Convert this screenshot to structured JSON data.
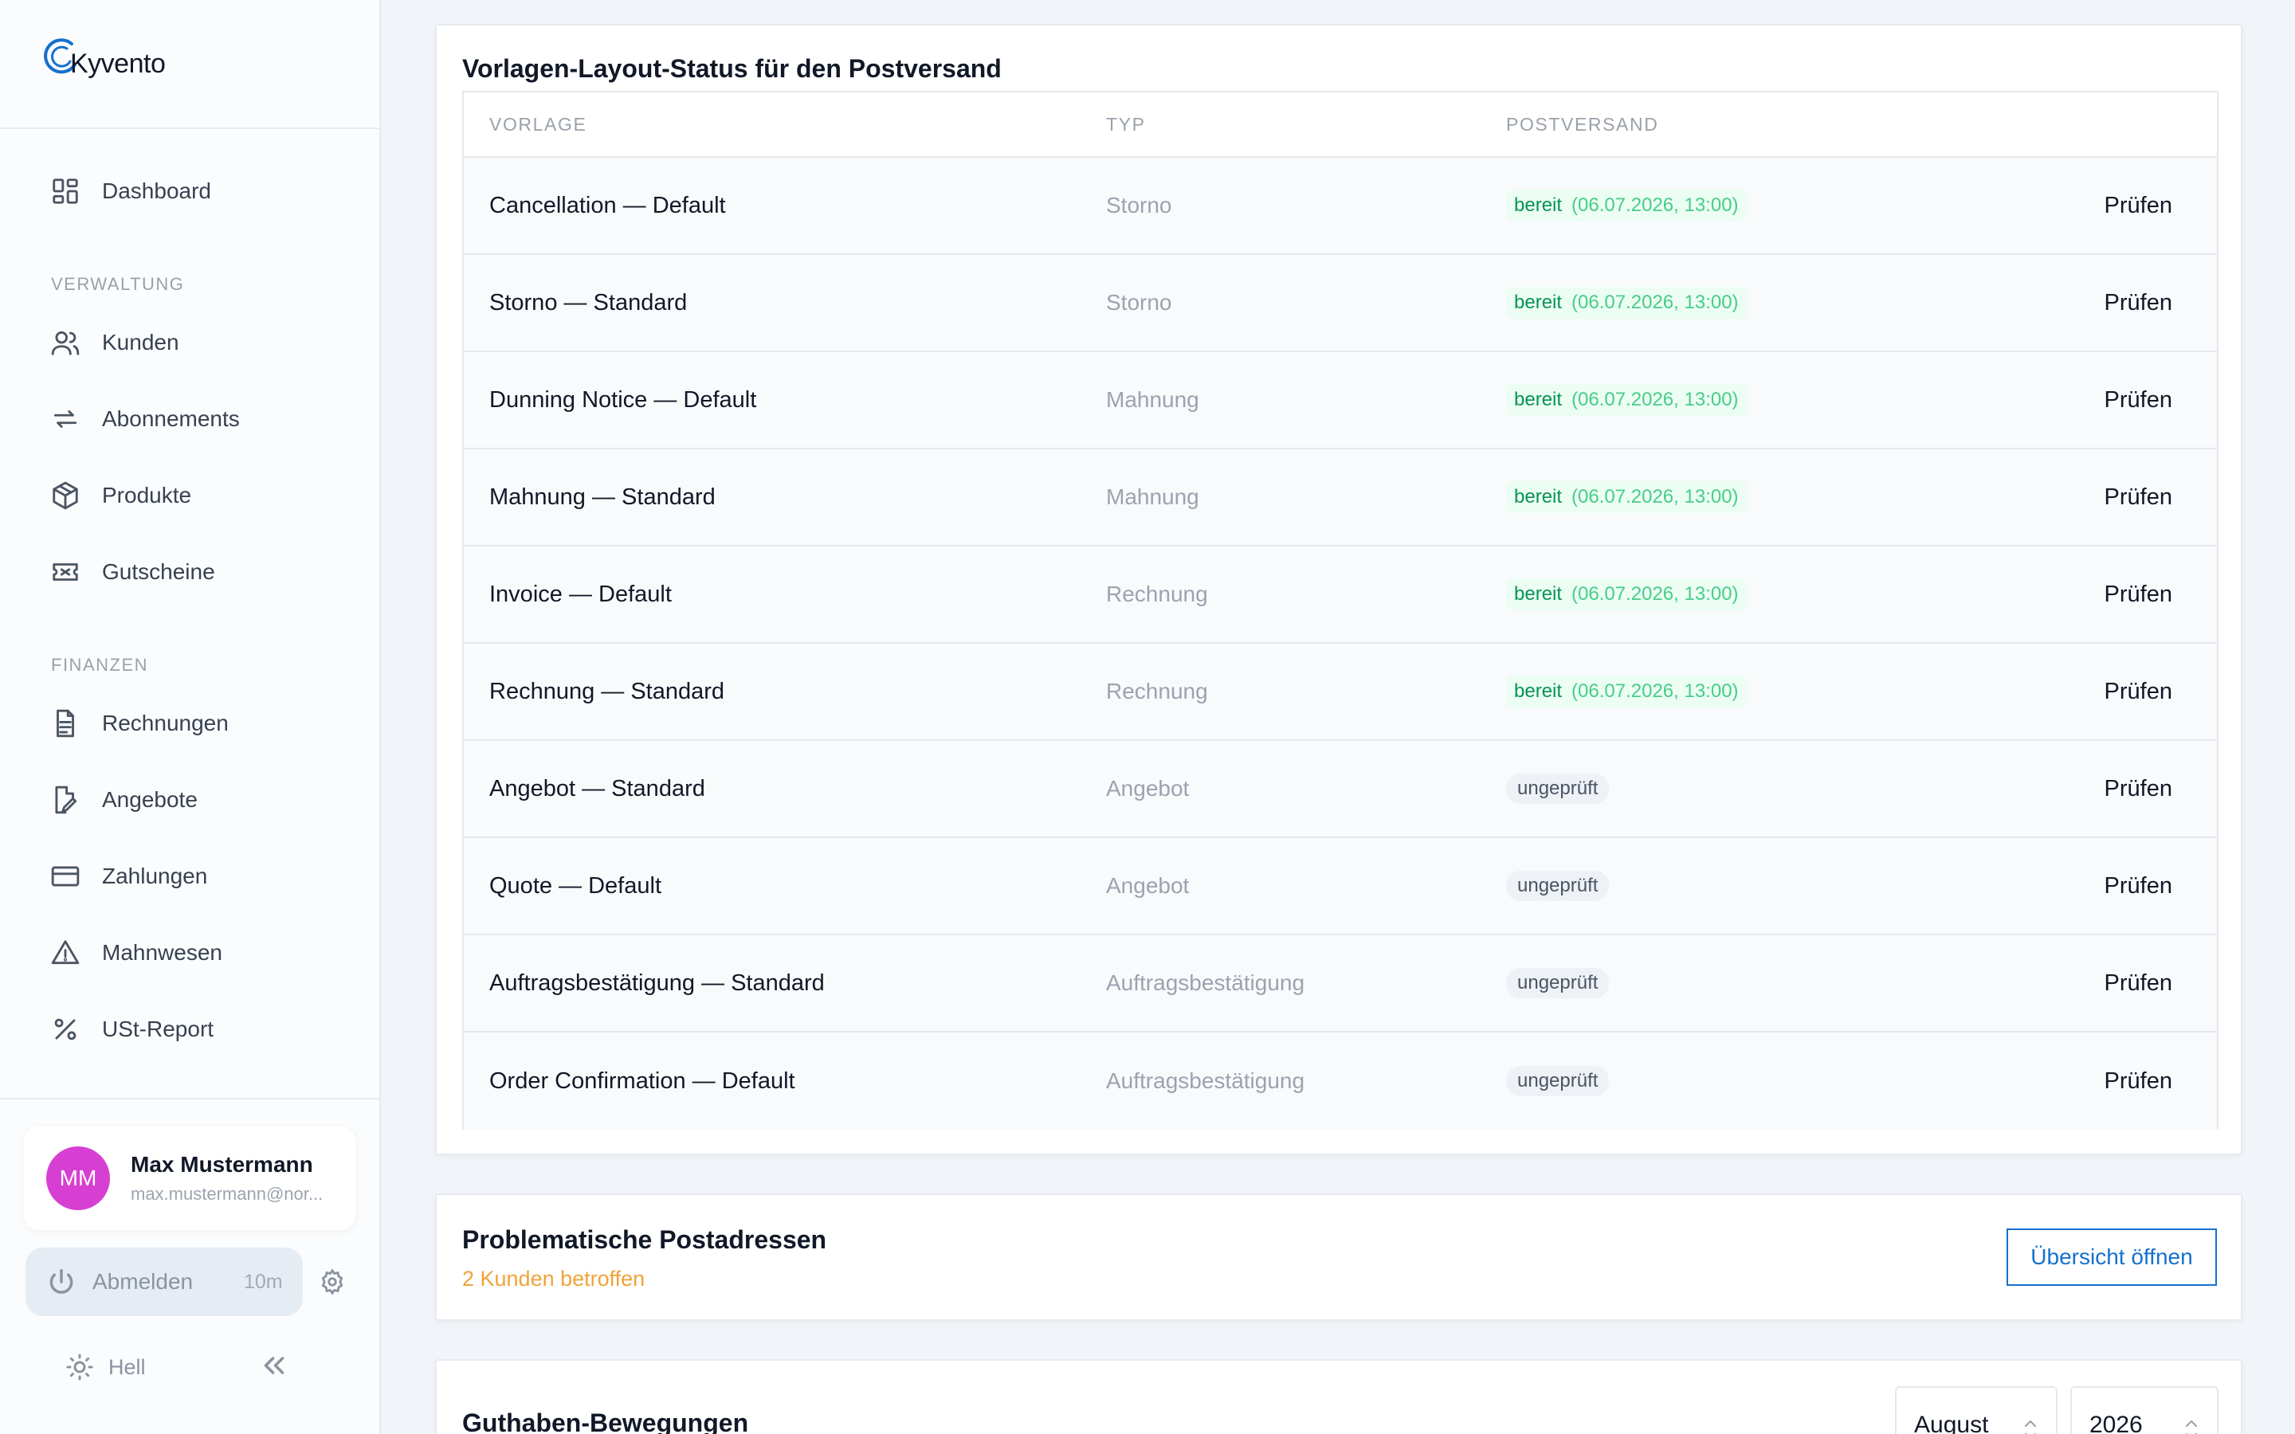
{
  "brand": {
    "name": "Kyvento"
  },
  "nav": {
    "dashboard": "Dashboard",
    "section_verwaltung": "VERWALTUNG",
    "kunden": "Kunden",
    "abonnements": "Abonnements",
    "produkte": "Produkte",
    "gutscheine": "Gutscheine",
    "section_finanzen": "FINANZEN",
    "rechnungen": "Rechnungen",
    "angebote": "Angebote",
    "zahlungen": "Zahlungen",
    "mahnwesen": "Mahnwesen",
    "ust_report": "USt-Report"
  },
  "user": {
    "initials": "MM",
    "name": "Max Mustermann",
    "email": "max.mustermann@nor...",
    "avatar_color": "#d63fd1"
  },
  "session": {
    "logout_label": "Abmelden",
    "time_remaining": "10m"
  },
  "theme": {
    "label": "Hell"
  },
  "templates_card": {
    "title": "Vorlagen-Layout-Status für den Postversand",
    "headers": {
      "vorlage": "VORLAGE",
      "typ": "TYP",
      "postversand": "POSTVERSAND"
    },
    "action_label": "Prüfen",
    "rows": [
      {
        "name": "Cancellation — Default",
        "typ": "Storno",
        "status": "bereit",
        "date": "(06.07.2026, 13:00)"
      },
      {
        "name": "Storno — Standard",
        "typ": "Storno",
        "status": "bereit",
        "date": "(06.07.2026, 13:00)"
      },
      {
        "name": "Dunning Notice — Default",
        "typ": "Mahnung",
        "status": "bereit",
        "date": "(06.07.2026, 13:00)"
      },
      {
        "name": "Mahnung — Standard",
        "typ": "Mahnung",
        "status": "bereit",
        "date": "(06.07.2026, 13:00)"
      },
      {
        "name": "Invoice — Default",
        "typ": "Rechnung",
        "status": "bereit",
        "date": "(06.07.2026, 13:00)"
      },
      {
        "name": "Rechnung — Standard",
        "typ": "Rechnung",
        "status": "bereit",
        "date": "(06.07.2026, 13:00)"
      },
      {
        "name": "Angebot — Standard",
        "typ": "Angebot",
        "status": "ungeprüft"
      },
      {
        "name": "Quote — Default",
        "typ": "Angebot",
        "status": "ungeprüft"
      },
      {
        "name": "Auftragsbestätigung — Standard",
        "typ": "Auftragsbestätigung",
        "status": "ungeprüft"
      },
      {
        "name": "Order Confirmation — Default",
        "typ": "Auftragsbestätigung",
        "status": "ungeprüft"
      }
    ]
  },
  "addresses_card": {
    "title": "Problematische Postadressen",
    "subtitle": "2 Kunden betroffen",
    "button": "Übersicht öffnen"
  },
  "credit_card": {
    "title": "Guthaben-Bewegungen",
    "month": "August",
    "year": "2026"
  },
  "colors": {
    "accent": "#1570cf",
    "ready_text": "#079455",
    "ready_bg": "#ecfdf3",
    "warning": "#f0a23b"
  }
}
